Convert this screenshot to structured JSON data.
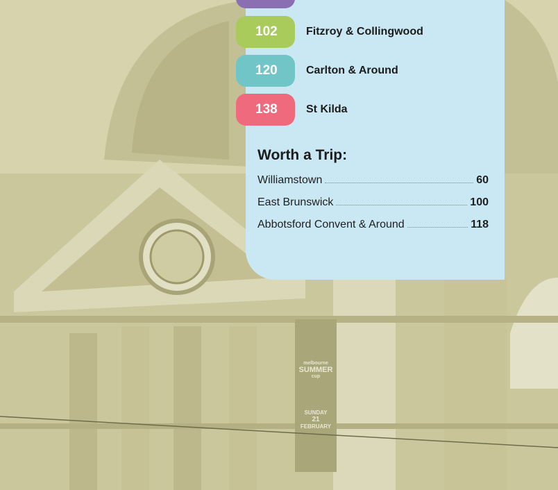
{
  "sections": [
    {
      "page": "102",
      "title": "Fitzroy & Collingwood",
      "color": "#a8cb5c"
    },
    {
      "page": "120",
      "title": "Carlton & Around",
      "color": "#71c5c6"
    },
    {
      "page": "138",
      "title": "St Kilda",
      "color": "#ee6a7c"
    }
  ],
  "top_tab_color": "#8a6fb2",
  "worth_a_trip": {
    "heading": "Worth a Trip:",
    "items": [
      {
        "title": "Williamstown",
        "page": "60"
      },
      {
        "title": "East Brunswick",
        "page": "100"
      },
      {
        "title": "Abbotsford Convent & Around",
        "page": "118"
      }
    ]
  },
  "photo_banner": {
    "brand": "melbourne",
    "event": "SUMMER",
    "cup": "cup",
    "day": "SUNDAY",
    "date": "21",
    "month": "FEBRUARY"
  }
}
